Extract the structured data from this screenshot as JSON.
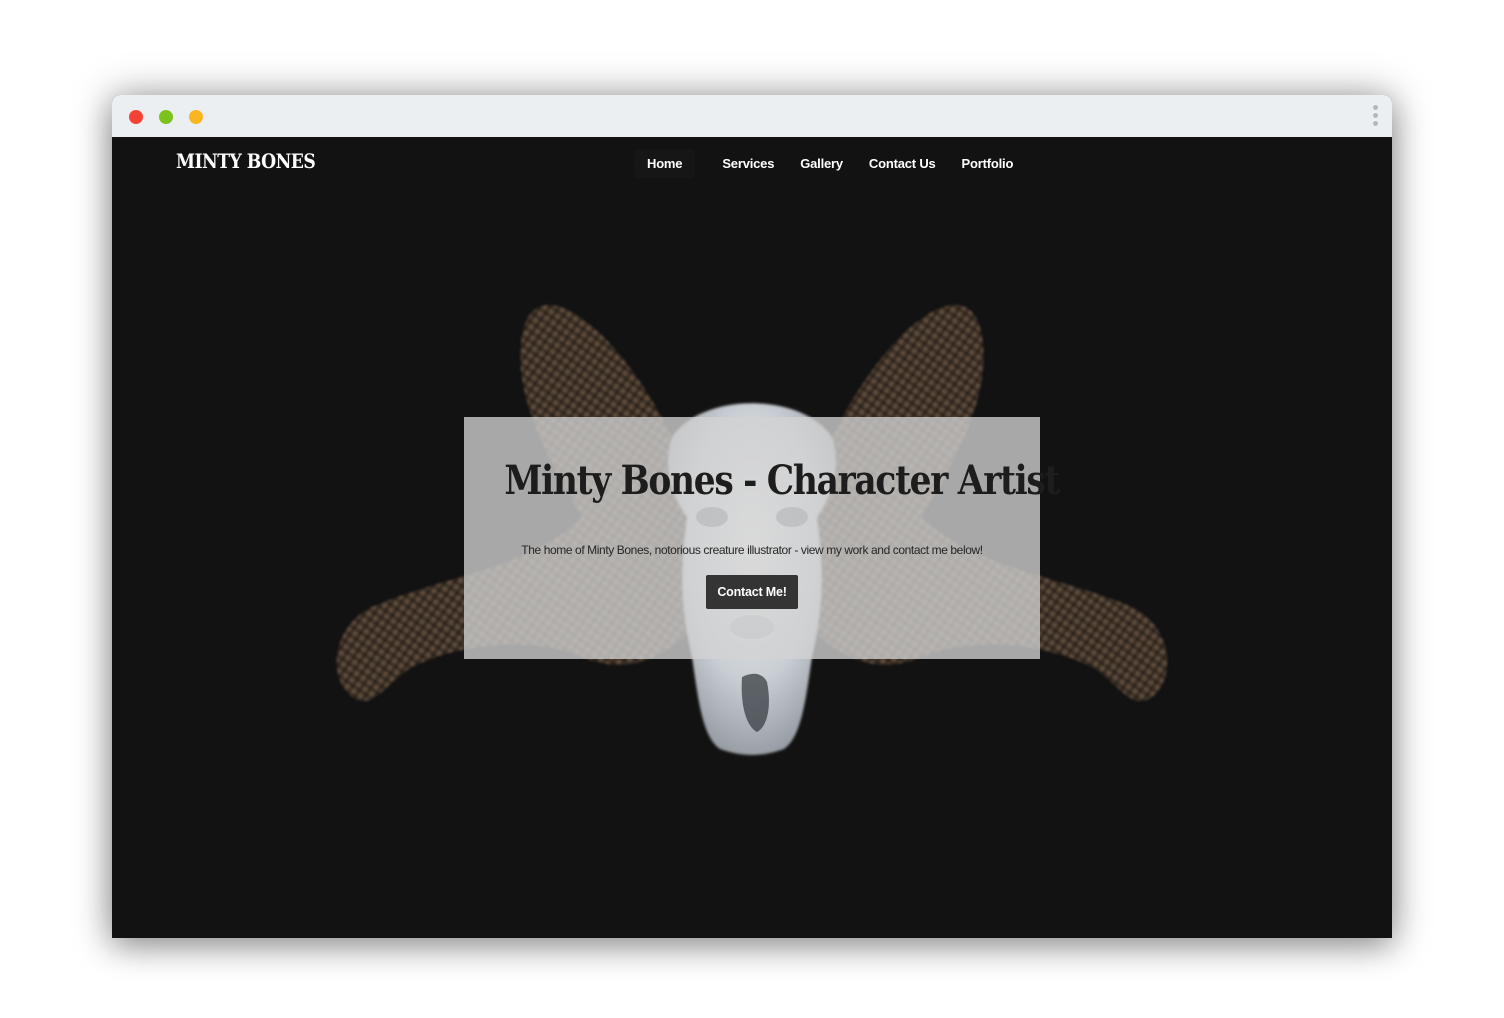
{
  "browser": {
    "window_controls": [
      "close",
      "minimize",
      "maximize"
    ],
    "menu_icon": "kebab-menu-icon"
  },
  "site": {
    "brand": "MINTY BONES"
  },
  "nav": {
    "items": [
      {
        "label": "Home",
        "active": true
      },
      {
        "label": "Services",
        "active": false
      },
      {
        "label": "Gallery",
        "active": false
      },
      {
        "label": "Contact Us",
        "active": false
      },
      {
        "label": "Portfolio",
        "active": false
      }
    ]
  },
  "hero": {
    "title": "Minty Bones - Character Artist",
    "subtitle": "The home of Minty Bones, notorious creature illustrator - view my work and contact me below!",
    "cta_label": "Contact Me!",
    "image": "ram-skull-illustration"
  },
  "colors": {
    "background": "#121212",
    "overlay": "#d2d2d2",
    "button": "#343434",
    "close_dot": "#f44336",
    "minimize_dot": "#7cc21a",
    "maximize_dot": "#f9b623"
  }
}
